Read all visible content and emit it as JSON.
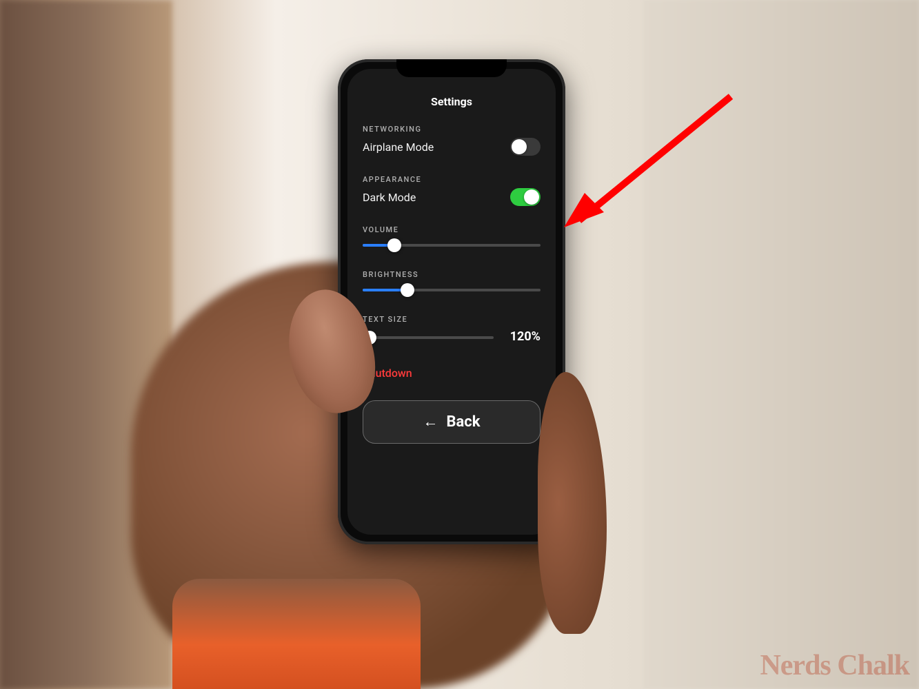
{
  "screen": {
    "title": "Settings"
  },
  "networking": {
    "section_label": "NETWORKING",
    "airplane": {
      "label": "Airplane Mode",
      "on": false
    }
  },
  "appearance": {
    "section_label": "APPEARANCE",
    "darkmode": {
      "label": "Dark Mode",
      "on": true
    }
  },
  "volume": {
    "section_label": "VOLUME",
    "percent": 18
  },
  "brightness": {
    "section_label": "BRIGHTNESS",
    "percent": 25
  },
  "textsize": {
    "section_label": "TEXT SIZE",
    "percent": 5,
    "value_label": "120%"
  },
  "shutdown_label": "Shutdown",
  "back_label": "Back",
  "watermark": "Nerds Chalk",
  "colors": {
    "accent_blue": "#2a7fff",
    "toggle_on_green": "#2ecc40",
    "shutdown_red": "#ff3b3b",
    "arrow_red": "#ff0000"
  }
}
